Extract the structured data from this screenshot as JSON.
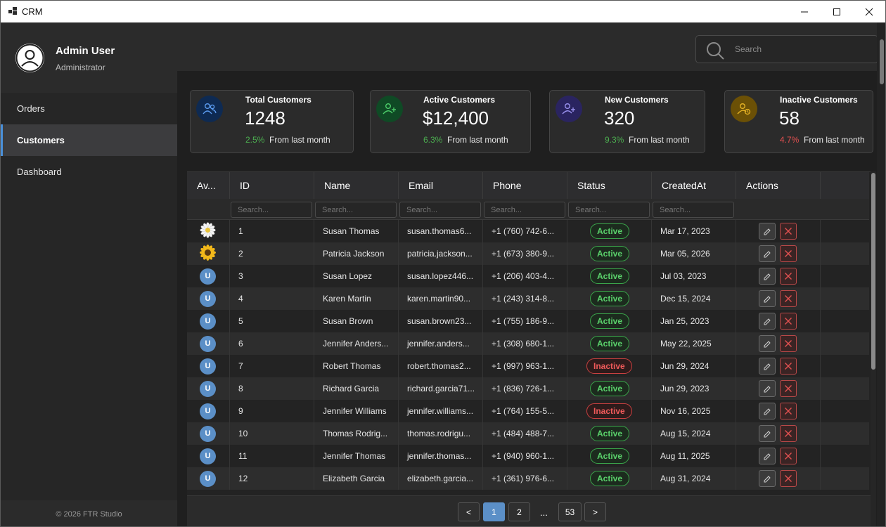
{
  "window": {
    "title": "CRM"
  },
  "profile": {
    "name": "Admin User",
    "role": "Administrator"
  },
  "nav": {
    "items": [
      {
        "label": "Orders"
      },
      {
        "label": "Customers"
      },
      {
        "label": "Dashboard"
      }
    ]
  },
  "footer": {
    "text": "© 2026 FTR Studio"
  },
  "search": {
    "placeholder": "Search"
  },
  "stats": [
    {
      "title": "Total Customers",
      "value": "1248",
      "change": "2.5%",
      "from": "From last month",
      "change_color": "#4caf50",
      "icon": "users-icon",
      "icon_bg": "#0e2a52",
      "icon_color": "#5b9bef"
    },
    {
      "title": "Active Customers",
      "value": "$12,400",
      "change": "6.3%",
      "from": "From last month",
      "change_color": "#4caf50",
      "icon": "user-plus-icon",
      "icon_bg": "#0f4a25",
      "icon_color": "#4ccd6a"
    },
    {
      "title": "New Customers",
      "value": "320",
      "change": "9.3%",
      "from": "From last month",
      "change_color": "#4caf50",
      "icon": "user-plus-icon",
      "icon_bg": "#2a2460",
      "icon_color": "#9a92ef"
    },
    {
      "title": "Inactive Customers",
      "value": "58",
      "change": "4.7%",
      "from": "From last month",
      "change_color": "#e05050",
      "icon": "user-clock-icon",
      "icon_bg": "#6b5006",
      "icon_color": "#e6b325"
    }
  ],
  "table": {
    "headers": {
      "avatar": "Av...",
      "id": "ID",
      "name": "Name",
      "email": "Email",
      "phone": "Phone",
      "status": "Status",
      "created": "CreatedAt",
      "actions": "Actions"
    },
    "filter_placeholder": "Search...",
    "rows": [
      {
        "avatar": "daisy",
        "id": "1",
        "name": "Susan Thomas",
        "email": "susan.thomas6...",
        "phone": "+1 (760) 742-6...",
        "status": "Active",
        "created": "Mar 17, 2023"
      },
      {
        "avatar": "sunflower",
        "id": "2",
        "name": "Patricia Jackson",
        "email": "patricia.jackson...",
        "phone": "+1 (673) 380-9...",
        "status": "Active",
        "created": "Mar 05, 2026"
      },
      {
        "avatar": "U",
        "id": "3",
        "name": "Susan Lopez",
        "email": "susan.lopez446...",
        "phone": "+1 (206) 403-4...",
        "status": "Active",
        "created": "Jul 03, 2023"
      },
      {
        "avatar": "U",
        "id": "4",
        "name": "Karen Martin",
        "email": "karen.martin90...",
        "phone": "+1 (243) 314-8...",
        "status": "Active",
        "created": "Dec 15, 2024"
      },
      {
        "avatar": "U",
        "id": "5",
        "name": "Susan Brown",
        "email": "susan.brown23...",
        "phone": "+1 (755) 186-9...",
        "status": "Active",
        "created": "Jan 25, 2023"
      },
      {
        "avatar": "U",
        "id": "6",
        "name": "Jennifer  Anders...",
        "email": "jennifer.anders...",
        "phone": "+1 (308) 680-1...",
        "status": "Active",
        "created": "May 22, 2025"
      },
      {
        "avatar": "U",
        "id": "7",
        "name": "Robert Thomas",
        "email": "robert.thomas2...",
        "phone": "+1 (997) 963-1...",
        "status": "Inactive",
        "created": "Jun 29, 2024"
      },
      {
        "avatar": "U",
        "id": "8",
        "name": "Richard Garcia",
        "email": "richard.garcia71...",
        "phone": "+1 (836) 726-1...",
        "status": "Active",
        "created": "Jun 29, 2023"
      },
      {
        "avatar": "U",
        "id": "9",
        "name": "Jennifer Williams",
        "email": "jennifer.williams...",
        "phone": "+1 (764) 155-5...",
        "status": "Inactive",
        "created": "Nov 16, 2025"
      },
      {
        "avatar": "U",
        "id": "10",
        "name": "Thomas  Rodrig...",
        "email": "thomas.rodrigu...",
        "phone": "+1 (484) 488-7...",
        "status": "Active",
        "created": "Aug 15, 2024"
      },
      {
        "avatar": "U",
        "id": "11",
        "name": "Jennifer Thomas",
        "email": "jennifer.thomas...",
        "phone": "+1 (940) 960-1...",
        "status": "Active",
        "created": "Aug 11, 2025"
      },
      {
        "avatar": "U",
        "id": "12",
        "name": "Elizabeth Garcia",
        "email": "elizabeth.garcia...",
        "phone": "+1 (361) 976-6...",
        "status": "Active",
        "created": "Aug 31, 2024"
      }
    ]
  },
  "pager": {
    "prev": "<",
    "pages": [
      "1",
      "2"
    ],
    "ellipsis": "...",
    "last": "53",
    "next": ">",
    "current": "1"
  }
}
